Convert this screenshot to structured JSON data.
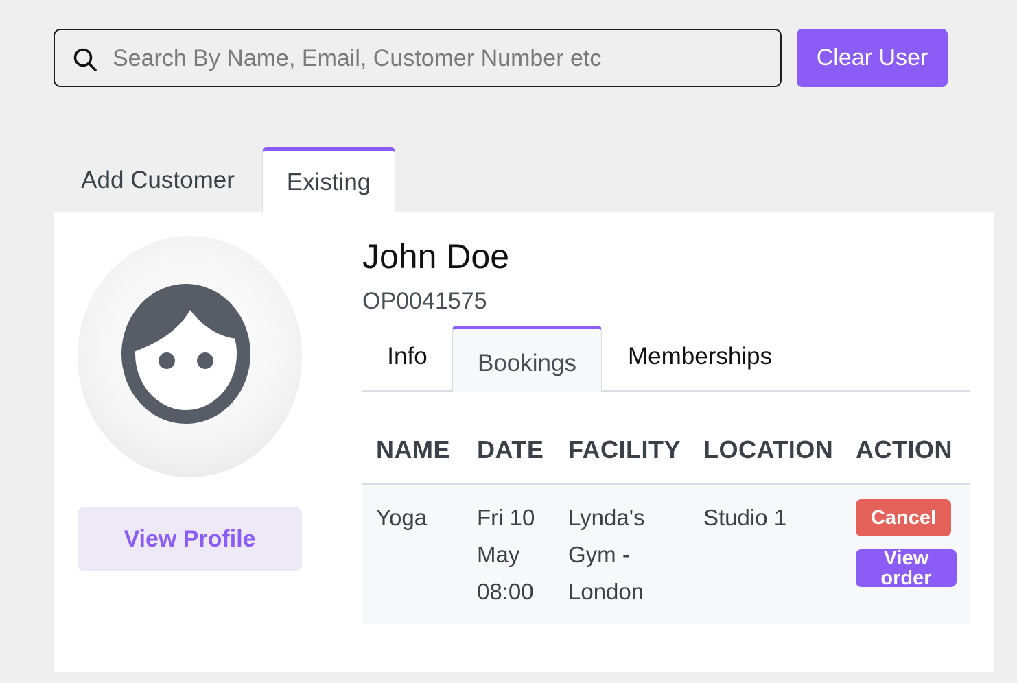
{
  "search": {
    "placeholder": "Search By Name, Email, Customer Number etc",
    "value": ""
  },
  "clear_user_label": "Clear User",
  "tabs": {
    "add_customer": "Add Customer",
    "existing": "Existing",
    "active": "Existing"
  },
  "customer": {
    "name": "John Doe",
    "number": "OP0041575",
    "view_profile_label": "View Profile"
  },
  "inner_tabs": {
    "info": "Info",
    "bookings": "Bookings",
    "memberships": "Memberships",
    "active": "Bookings"
  },
  "bookings_table": {
    "headers": [
      "NAME",
      "DATE",
      "FACILITY",
      "LOCATION",
      "ACTION"
    ],
    "rows": [
      {
        "name": "Yoga",
        "date": "Fri 10\nMay\n08:00",
        "facility": "Lynda's\nGym -\nLondon",
        "location": "Studio 1",
        "cancel_label": "Cancel",
        "view_order_label": "View\norder"
      }
    ]
  },
  "colors": {
    "accent": "#8b5cf6",
    "cancel": "#e5625a",
    "background": "#efefef",
    "panel": "#ffffff"
  },
  "icons": {
    "search": "search-icon",
    "avatar": "user-face-icon"
  }
}
